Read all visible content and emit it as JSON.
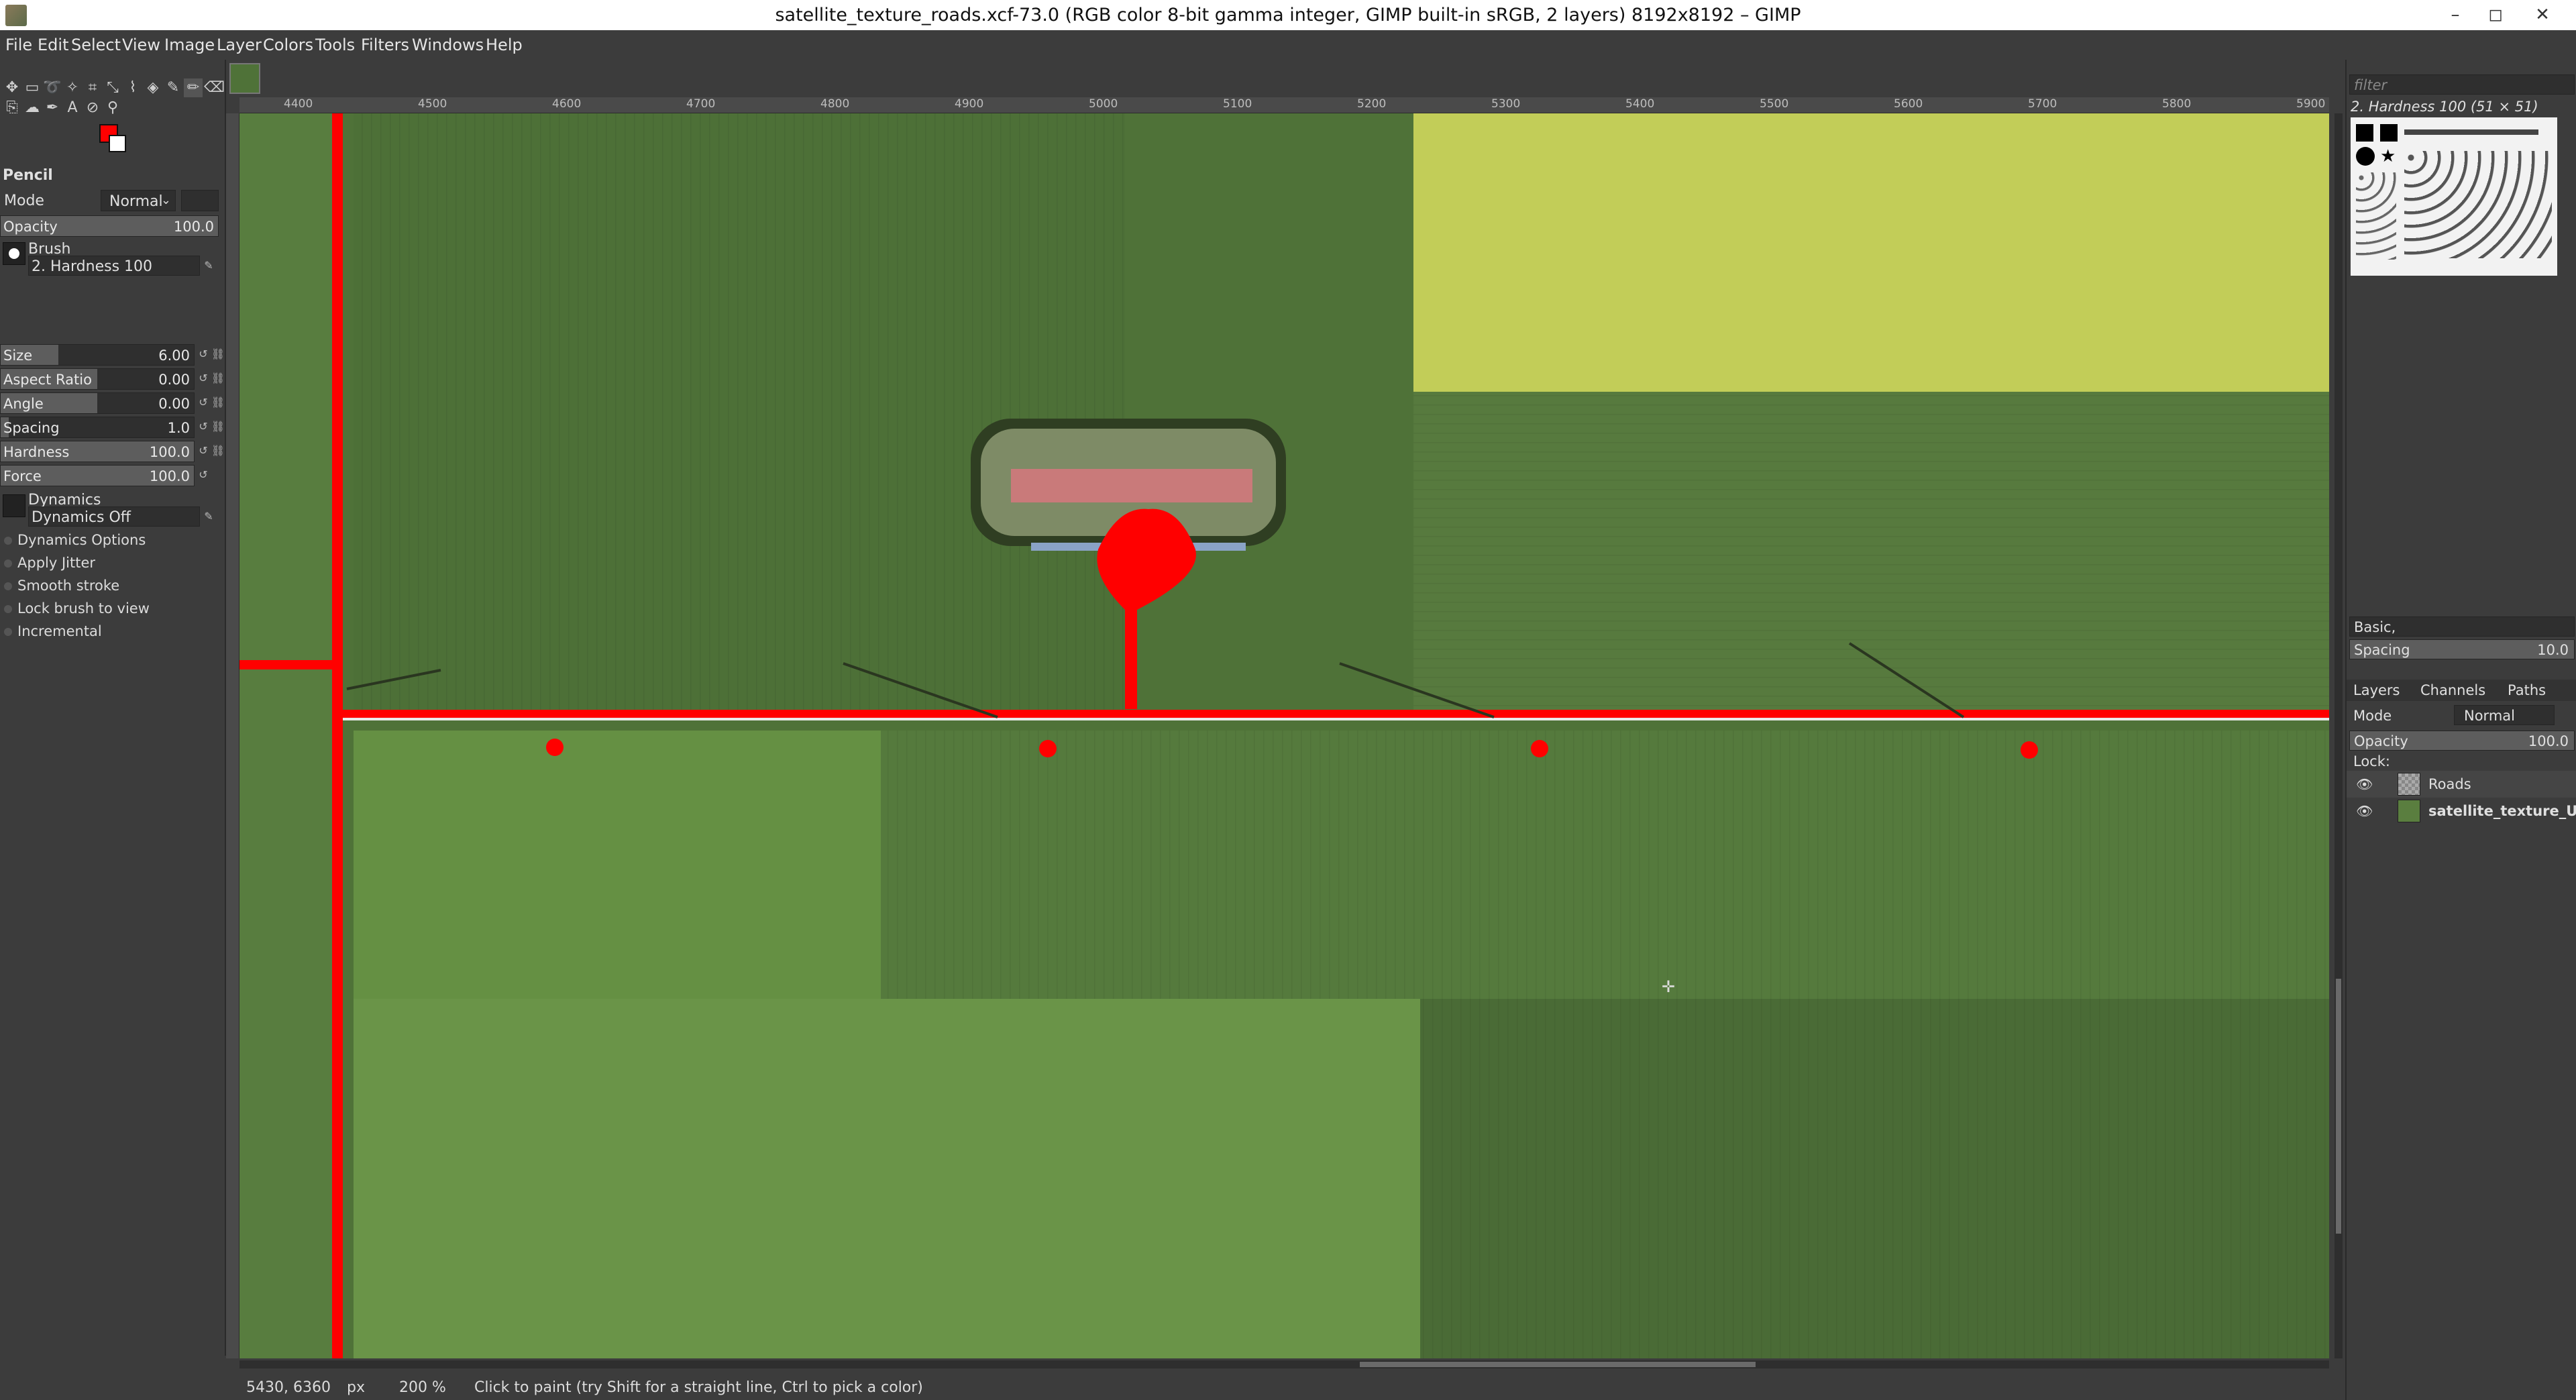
{
  "window": {
    "title": "satellite_texture_roads.xcf-73.0 (RGB color 8-bit gamma integer, GIMP built-in sRGB, 2 layers) 8192x8192 – GIMP",
    "minimize": "–",
    "maximize": "◻",
    "close": "✕"
  },
  "menu": [
    "File",
    "Edit",
    "Select",
    "View",
    "Image",
    "Layer",
    "Colors",
    "Tools",
    "Filters",
    "Windows",
    "Help"
  ],
  "colors": {
    "accent_red": "#ff0000",
    "field_dark": "#4f7238",
    "field_light": "#6a9348",
    "field_yellow": "#c8cf5a",
    "road_white": "#eeeeee"
  },
  "tool_options": {
    "tool_name": "Pencil",
    "mode_label": "Mode",
    "mode_value": "Normal",
    "opacity_label": "Opacity",
    "opacity_value": "100.0",
    "brush_label": "Brush",
    "brush_value": "2. Hardness 100",
    "size_label": "Size",
    "size_value": "6.00",
    "aspect_label": "Aspect Ratio",
    "aspect_value": "0.00",
    "angle_label": "Angle",
    "angle_value": "0.00",
    "spacing_label": "Spacing",
    "spacing_value": "1.0",
    "hardness_label": "Hardness",
    "hardness_value": "100.0",
    "force_label": "Force",
    "force_value": "100.0",
    "dynamics_label": "Dynamics",
    "dynamics_value": "Dynamics Off",
    "checks": [
      "Dynamics Options",
      "Apply Jitter",
      "Smooth stroke",
      "Lock brush to view",
      "Incremental"
    ]
  },
  "ruler": {
    "ticks": [
      "4400",
      "4500",
      "4600",
      "4700",
      "4800",
      "4900",
      "5000",
      "5100",
      "5200",
      "5300",
      "5400",
      "5500",
      "5600",
      "5700",
      "5800",
      "5900"
    ]
  },
  "status": {
    "coords": "5430, 6360",
    "unit": "px",
    "zoom": "200 %",
    "message": "Click to paint (try Shift for a straight line, Ctrl to pick a color)"
  },
  "brushes_panel": {
    "filter_placeholder": "filter",
    "selected": "2. Hardness 100 (51 × 51)",
    "preset": "Basic,",
    "spacing_label": "Spacing",
    "spacing_value": "10.0"
  },
  "layers_panel": {
    "tabs": [
      "Layers",
      "Channels",
      "Paths"
    ],
    "mode_label": "Mode",
    "mode_value": "Normal",
    "opacity_label": "Opacity",
    "opacity_value": "100.0",
    "lock_label": "Lock:",
    "layers": [
      {
        "name": "Roads"
      },
      {
        "name": "satellite_texture_U"
      }
    ]
  }
}
